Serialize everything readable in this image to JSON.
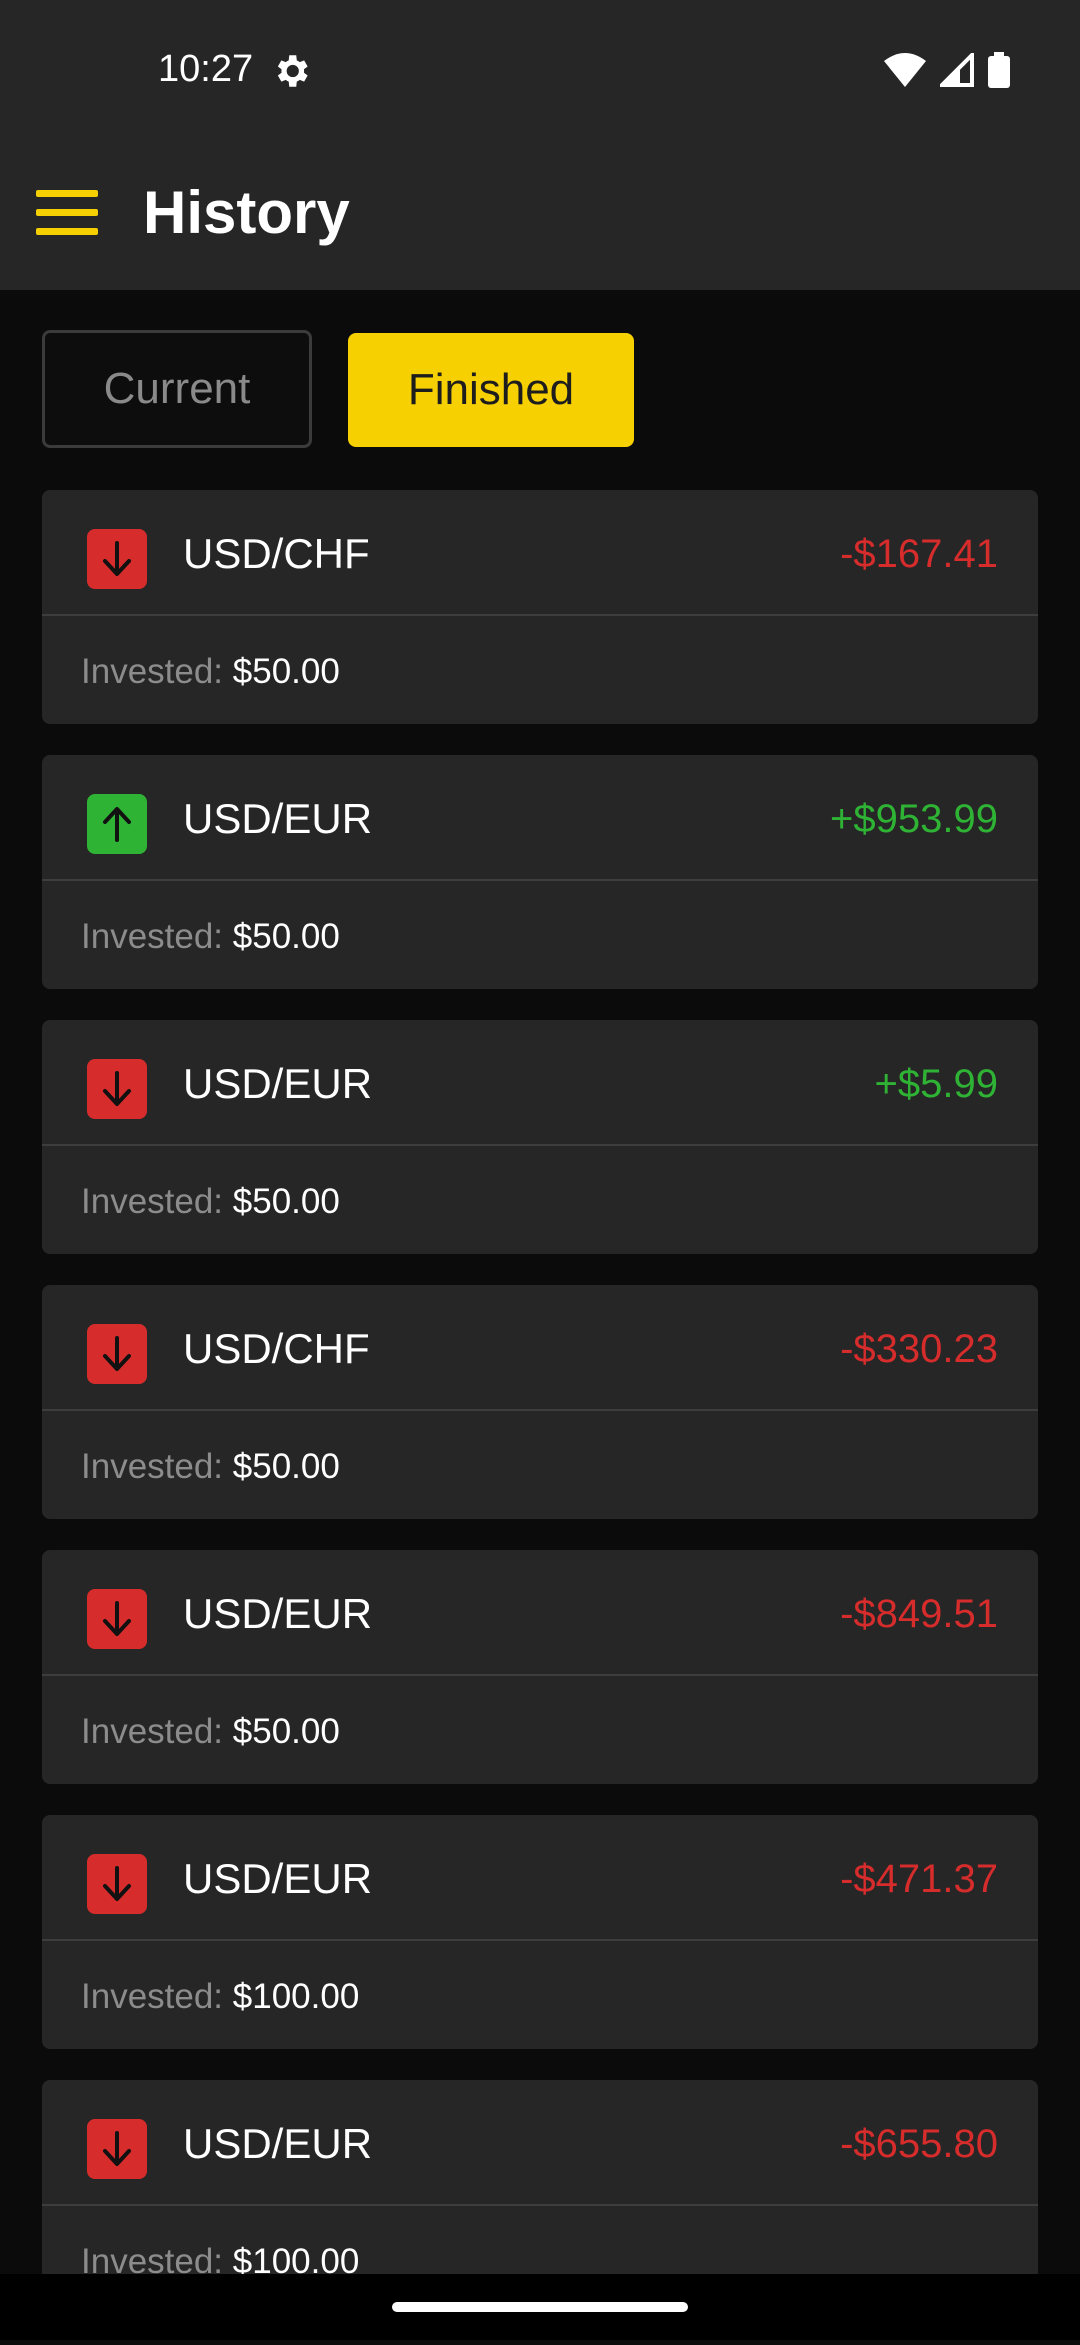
{
  "status_bar": {
    "time": "10:27",
    "icons": [
      "gear-icon",
      "wifi-icon",
      "signal-icon",
      "battery-icon"
    ]
  },
  "app_bar": {
    "title": "History",
    "menu_icon": "hamburger-menu-icon"
  },
  "tabs": {
    "current_label": "Current",
    "finished_label": "Finished",
    "selected": "Finished"
  },
  "colors": {
    "accent": "#f6d000",
    "positive": "#2fb335",
    "negative": "#d62c2c",
    "card_bg": "#262626",
    "page_bg": "#0b0b0b"
  },
  "trades": [
    {
      "direction": "down",
      "pair": "USD/CHF",
      "amount": "-$167.41",
      "result": "negative",
      "invested_label": "Invested:",
      "invested": "$50.00"
    },
    {
      "direction": "up",
      "pair": "USD/EUR",
      "amount": "+$953.99",
      "result": "positive",
      "invested_label": "Invested:",
      "invested": "$50.00"
    },
    {
      "direction": "down",
      "pair": "USD/EUR",
      "amount": "+$5.99",
      "result": "positive",
      "invested_label": "Invested:",
      "invested": "$50.00"
    },
    {
      "direction": "down",
      "pair": "USD/CHF",
      "amount": "-$330.23",
      "result": "negative",
      "invested_label": "Invested:",
      "invested": "$50.00"
    },
    {
      "direction": "down",
      "pair": "USD/EUR",
      "amount": "-$849.51",
      "result": "negative",
      "invested_label": "Invested:",
      "invested": "$50.00"
    },
    {
      "direction": "down",
      "pair": "USD/EUR",
      "amount": "-$471.37",
      "result": "negative",
      "invested_label": "Invested:",
      "invested": "$100.00"
    },
    {
      "direction": "down",
      "pair": "USD/EUR",
      "amount": "-$655.80",
      "result": "negative",
      "invested_label": "Invested:",
      "invested": "$100.00"
    }
  ]
}
